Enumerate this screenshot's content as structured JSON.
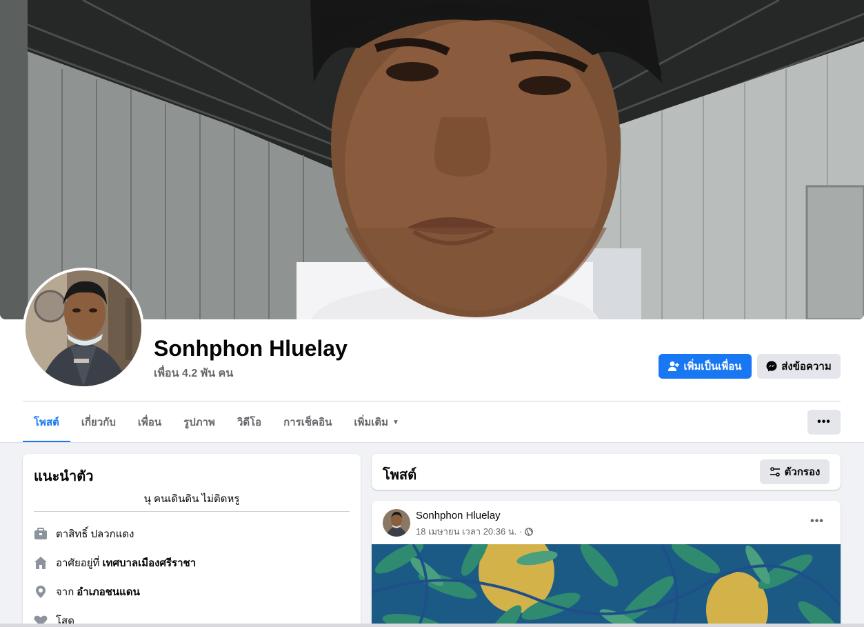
{
  "profile": {
    "name": "Sonhphon Hluelay",
    "friend_count": "เพื่อน 4.2 พัน คน",
    "add_friend_label": "เพิ่มเป็นเพื่อน",
    "message_label": "ส่งข้อความ"
  },
  "tabs": [
    {
      "label": "โพสต์"
    },
    {
      "label": "เกี่ยวกับ"
    },
    {
      "label": "เพื่อน"
    },
    {
      "label": "รูปภาพ"
    },
    {
      "label": "วิดีโอ"
    },
    {
      "label": "การเช็คอิน"
    },
    {
      "label": "เพิ่มเติม"
    }
  ],
  "more_label": "•••",
  "intro": {
    "title": "แนะนำตัว",
    "bio": "นุ คนเดินดิน ไม่ติดหรู",
    "work": "ตาสิทธิ์ ปลวกแดง",
    "lives_prefix": "อาศัยอยู่ที่",
    "lives_value": "เทศบาลเมืองศรีราชา",
    "from_prefix": "จาก",
    "from_value": "อำเภอชนแดน",
    "relationship": "โสด"
  },
  "posts_section": {
    "title": "โพสต์",
    "filter_label": "ตัวกรอง"
  },
  "post": {
    "author": "Sonhphon Hluelay",
    "timestamp": "18 เมษายน เวลา 20:36 น. ·",
    "more_label": "•••"
  },
  "colors": {
    "accent": "#1877f2",
    "secondary_button": "#e4e6eb",
    "page_background": "#f0f2f5",
    "muted_text": "#65676b"
  }
}
